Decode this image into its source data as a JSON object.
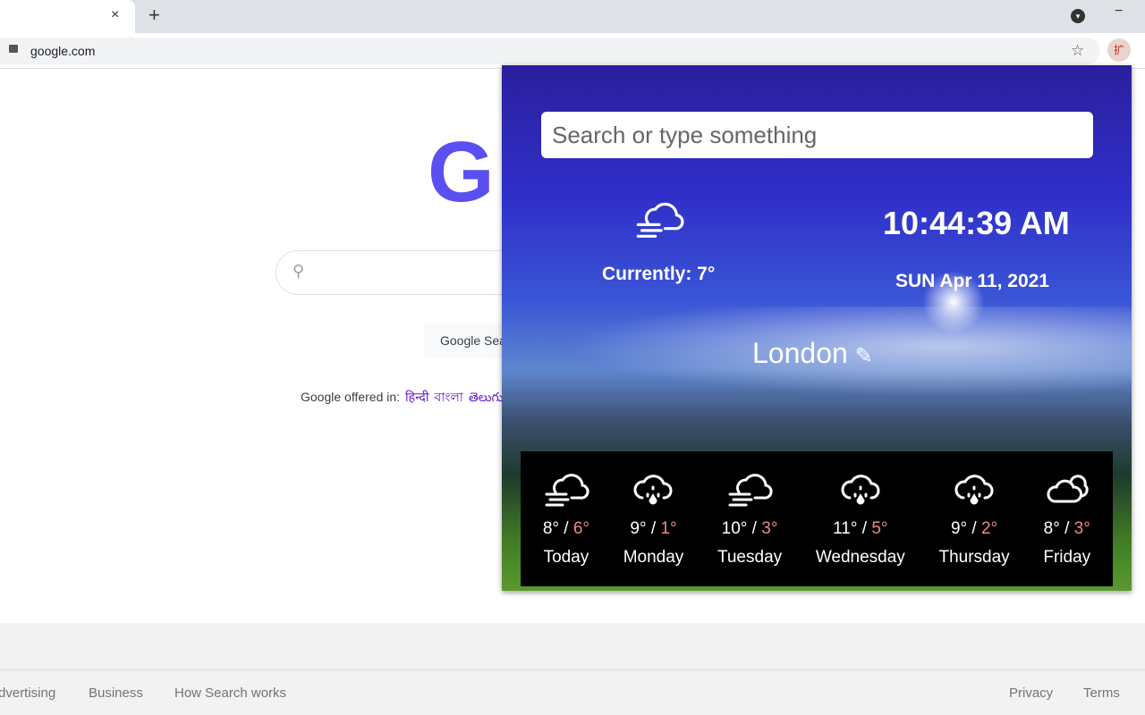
{
  "browser": {
    "tab_close": "×",
    "new_tab": "+",
    "minimize": "−",
    "url": "google.com",
    "star": "☆",
    "ext_label": "扩"
  },
  "google": {
    "logo": "G",
    "search_icon": "⚲",
    "button": "Google Search",
    "offered_in": "Google offered in:",
    "languages": [
      "हिन्दी",
      "বাংলা",
      "తెలుగు"
    ]
  },
  "footer": {
    "left": [
      "Advertising",
      "Business",
      "How Search works"
    ],
    "right": [
      "Privacy",
      "Terms"
    ]
  },
  "popup": {
    "search_placeholder": "Search or type something",
    "current_label": "Currently: 7°",
    "current_icon": "fog-cloud-icon",
    "time": "10:44:39 AM",
    "date": "SUN Apr 11, 2021",
    "city": "London",
    "edit_icon": "✎",
    "forecast": [
      {
        "day": "Today",
        "high": "8°",
        "low": "6°",
        "icon": "fog"
      },
      {
        "day": "Monday",
        "high": "9°",
        "low": "1°",
        "icon": "rain"
      },
      {
        "day": "Tuesday",
        "high": "10°",
        "low": "3°",
        "icon": "fog"
      },
      {
        "day": "Wednesday",
        "high": "11°",
        "low": "5°",
        "icon": "rain"
      },
      {
        "day": "Thursday",
        "high": "9°",
        "low": "2°",
        "icon": "rain"
      },
      {
        "day": "Friday",
        "high": "8°",
        "low": "3°",
        "icon": "clouds"
      }
    ]
  },
  "colors": {
    "low_temp": "#ee8888",
    "forecast_bg": "#000000"
  }
}
